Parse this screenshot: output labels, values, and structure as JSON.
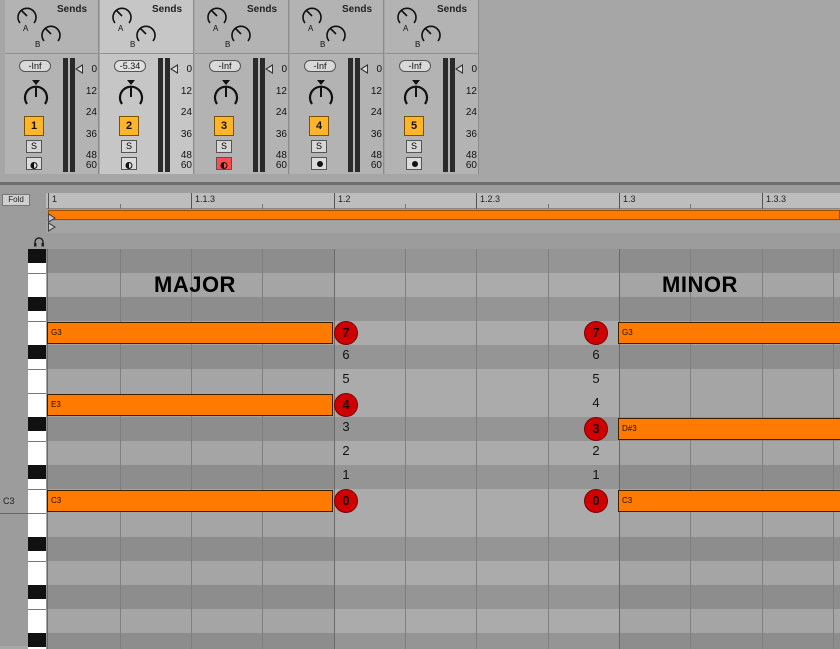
{
  "mixer": {
    "sends_label": "Sends",
    "knob_a": "A",
    "knob_b": "B",
    "solo_label": "S",
    "meter_scale": [
      "0",
      "12",
      "24",
      "36",
      "48",
      "60"
    ],
    "tracks": [
      {
        "number": "1",
        "volume": "-Inf",
        "selected": false,
        "armed": false
      },
      {
        "number": "2",
        "volume": "-5.34",
        "selected": true,
        "armed": false
      },
      {
        "number": "3",
        "volume": "-Inf",
        "selected": false,
        "armed": true
      },
      {
        "number": "4",
        "volume": "-Inf",
        "selected": false,
        "armed": false
      },
      {
        "number": "5",
        "volume": "-Inf",
        "selected": false,
        "armed": false
      }
    ]
  },
  "piano_roll": {
    "fold_label": "Fold",
    "c3_label": "C3",
    "ruler": [
      "1",
      "1.1.3",
      "1.2",
      "1.2.3",
      "1.3",
      "1.3.3"
    ],
    "major_label": "MAJOR",
    "minor_label": "MINOR",
    "notes": {
      "major_g3": "G3",
      "major_e3": "E3",
      "major_c3": "C3",
      "minor_g3": "G3",
      "minor_ds3": "D#3",
      "minor_c3": "C3"
    },
    "major_intervals": {
      "n7": "7",
      "n6": "6",
      "n5": "5",
      "n4": "4",
      "n3": "3",
      "n2": "2",
      "n1": "1",
      "n0": "0"
    },
    "minor_intervals": {
      "n7": "7",
      "n6": "6",
      "n5": "5",
      "n4": "4",
      "n3": "3",
      "n2": "2",
      "n1": "1",
      "n0": "0"
    }
  },
  "colors": {
    "note": "#ff7a00",
    "track_number": "#ffb52a",
    "interval_circle": "#d10000",
    "arm_active": "#ff4d4d"
  }
}
